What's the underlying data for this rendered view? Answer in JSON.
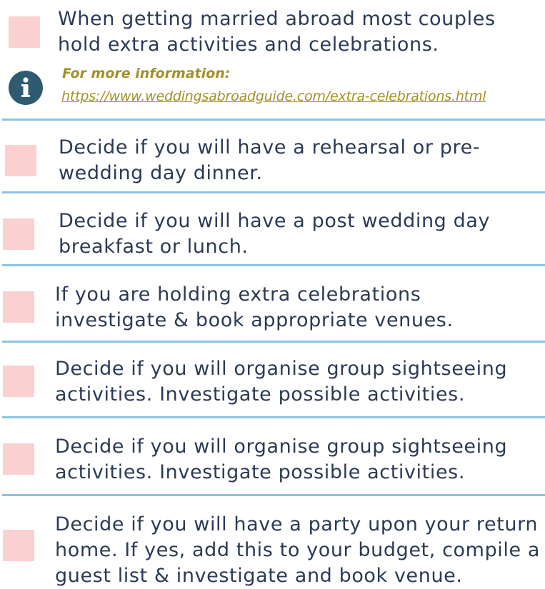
{
  "intro": {
    "text_line1": "When getting married abroad most couples",
    "text_line2": "hold extra activities and celebrations."
  },
  "info": {
    "icon": "info-icon",
    "label": "For more information:",
    "link": "https://www.weddingsabroadguide.com/extra-celebrations.html"
  },
  "colors": {
    "checkbox": "#fbd0d1",
    "divider": "#8cc4de",
    "text": "#2b3a55",
    "info_accent": "#a38f2b",
    "info_icon_bg": "#2e5b70"
  },
  "tasks": [
    {
      "line1": "Decide if you will have a rehearsal or pre-",
      "line2": "wedding day dinner."
    },
    {
      "line1": "Decide if you will have a post wedding day",
      "line2": "breakfast or lunch."
    },
    {
      "line1": "If you are holding extra celebrations",
      "line2": "investigate & book appropriate venues."
    },
    {
      "line1": "Decide if you will organise group sightseeing",
      "line2": "activities. Investigate possible activities."
    },
    {
      "line1": "Decide if you will organise group sightseeing",
      "line2": "activities. Investigate possible activities."
    },
    {
      "line1": "Decide if you will have a party upon your return",
      "line2": "home. If yes, add this to your budget, compile a",
      "line3": "guest list & investigate and book venue."
    }
  ]
}
